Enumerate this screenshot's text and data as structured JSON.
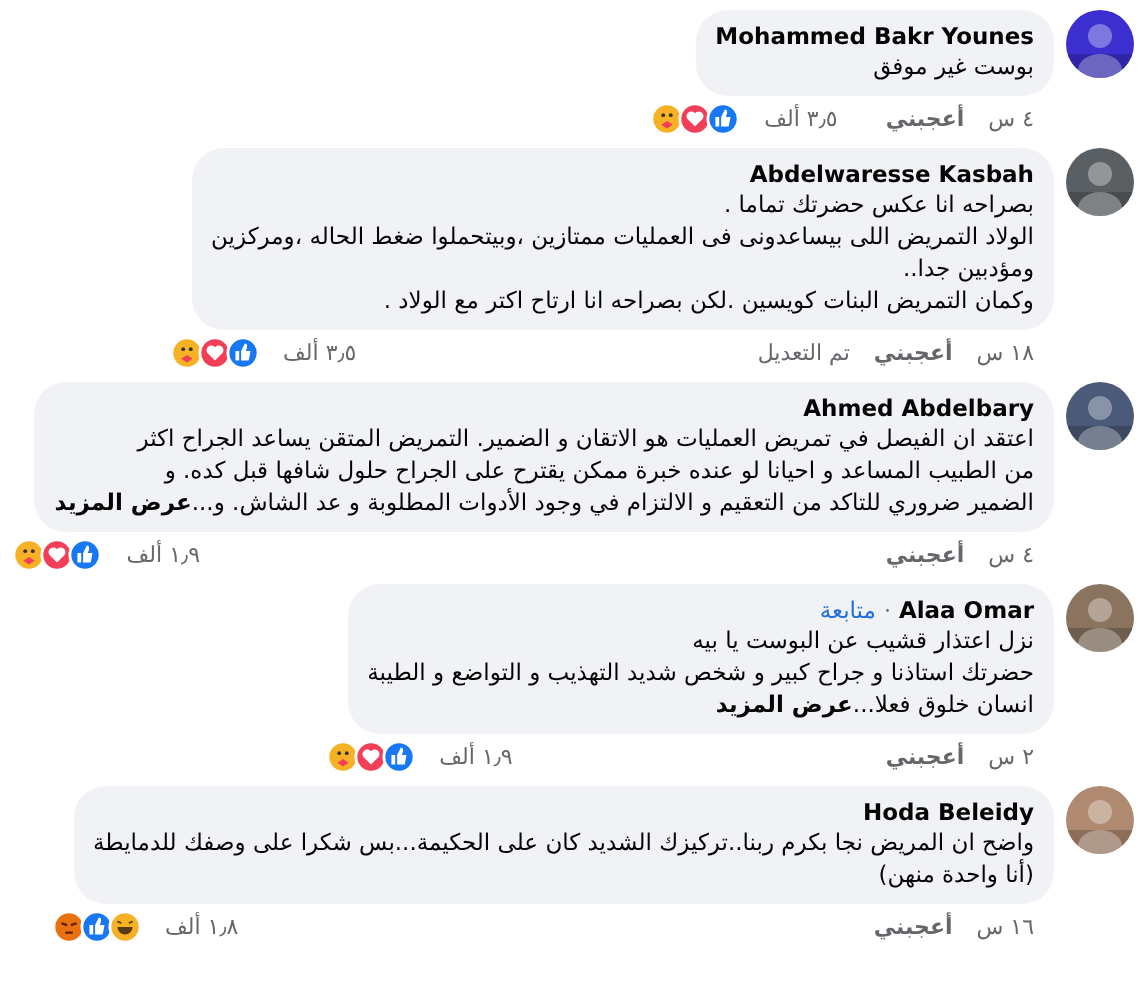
{
  "comments": [
    {
      "name": "Mohammed Bakr Younes",
      "lines": [
        "بوست غير موفق"
      ],
      "time": "٤ س",
      "like": "أعجبني",
      "reaction_count": "٣٫٥ ألف",
      "reactions": [
        {
          "kind": "like"
        },
        {
          "kind": "love"
        },
        {
          "kind": "care"
        }
      ]
    },
    {
      "name": "Abdelwaresse Kasbah",
      "lines": [
        "بصراحه انا عكس حضرتك تماما .",
        "الولاد التمريض اللى بيساعدونى فى العمليات ممتازين ،وبيتحملوا ضغط الحاله ،ومركزين",
        "ومؤدبين جدا..",
        "وكمان التمريض البنات كويسين .لكن بصراحه انا ارتاح اكتر مع الولاد ."
      ],
      "time": "١٨ س",
      "like": "أعجبني",
      "edited": "تم التعديل",
      "reaction_count": "٣٫٥ ألف",
      "reactions": [
        {
          "kind": "like"
        },
        {
          "kind": "love"
        },
        {
          "kind": "care"
        }
      ]
    },
    {
      "name": "Ahmed Abdelbary",
      "lines": [
        "اعتقد ان الفيصل في تمريض العمليات هو الاتقان و الضمير. التمريض المتقن يساعد الجراح اكثر",
        "من الطبيب المساعد و احيانا لو عنده خبرة ممكن يقترح على الجراح حلول شافها قبل كده. و",
        "الضمير ضروري للتاكد من التعقيم و الالتزام في وجود الأدوات المطلوبة و عد الشاش. و..."
      ],
      "see_more": "عرض المزيد",
      "time": "٤ س",
      "like": "أعجبني",
      "reaction_count": "١٫٩ ألف",
      "reactions": [
        {
          "kind": "like"
        },
        {
          "kind": "love"
        },
        {
          "kind": "care"
        }
      ]
    },
    {
      "name": "Alaa Omar",
      "separator": "·",
      "badge": "متابعة",
      "lines": [
        "نزل اعتذار قشيب عن البوست يا بيه",
        "حضرتك استاذنا و جراح كبير و شخص شديد التهذيب و التواضع و الطيبة",
        "انسان خلوق فعلا..."
      ],
      "see_more": "عرض المزيد",
      "time": "٢ س",
      "like": "أعجبني",
      "reaction_count": "١٫٩ ألف",
      "reactions": [
        {
          "kind": "like"
        },
        {
          "kind": "love"
        },
        {
          "kind": "care"
        }
      ]
    },
    {
      "name": "Hoda Beleidy",
      "lines": [
        "واضح ان المريض نجا بكرم ربنا..تركيزك الشديد كان على الحكيمة...بس شكرا على وصفك للدمايطة",
        "(أنا واحدة منهن)"
      ],
      "time": "١٦ س",
      "like": "أعجبني",
      "reaction_count": "١٫٨ ألف",
      "reactions": [
        {
          "kind": "haha"
        },
        {
          "kind": "like"
        },
        {
          "kind": "angry"
        }
      ]
    }
  ]
}
